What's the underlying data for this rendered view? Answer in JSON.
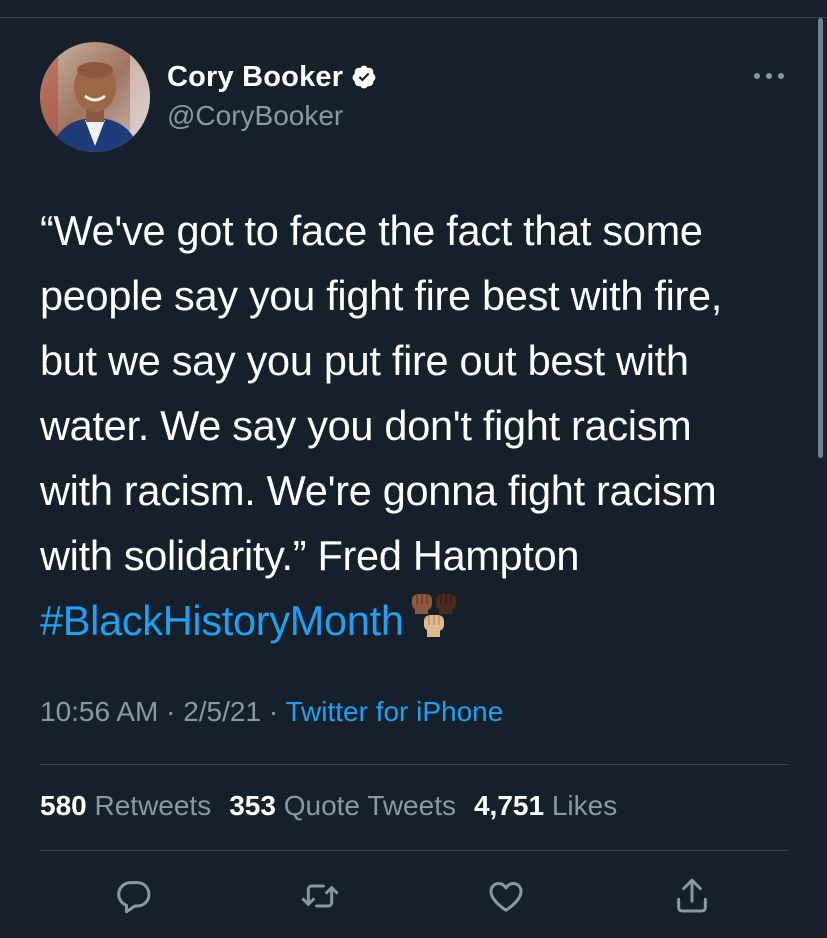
{
  "header": {
    "display_name": "Cory Booker",
    "handle": "@CoryBooker",
    "verified_icon": "verified-badge-icon",
    "more_icon": "more-options-icon"
  },
  "tweet": {
    "lines": [
      "“We've got to face the fact that some",
      "people say you fight fire best with fire,",
      "but we say you put fire out best with",
      "water. We say you don't fight racism",
      "with racism. We're gonna fight racism",
      "with solidarity.” Fred Hampton"
    ],
    "hashtag": "#BlackHistoryMonth",
    "emoji_icon": "raised-fists-emoji-icon"
  },
  "meta": {
    "time": "10:56 AM",
    "separator": " · ",
    "date": "2/5/21",
    "source": "Twitter for iPhone"
  },
  "stats": {
    "retweets_count": "580",
    "retweets_label": " Retweets",
    "quotes_count": "353",
    "quotes_label": " Quote Tweets",
    "likes_count": "4,751",
    "likes_label": " Likes"
  },
  "actions": {
    "reply_icon": "reply-icon",
    "retweet_icon": "retweet-icon",
    "like_icon": "heart-icon",
    "share_icon": "share-icon"
  },
  "colors": {
    "background": "#15202b",
    "accent": "#1da1f2",
    "secondary_text": "#8899a6",
    "divider": "#38444d"
  }
}
